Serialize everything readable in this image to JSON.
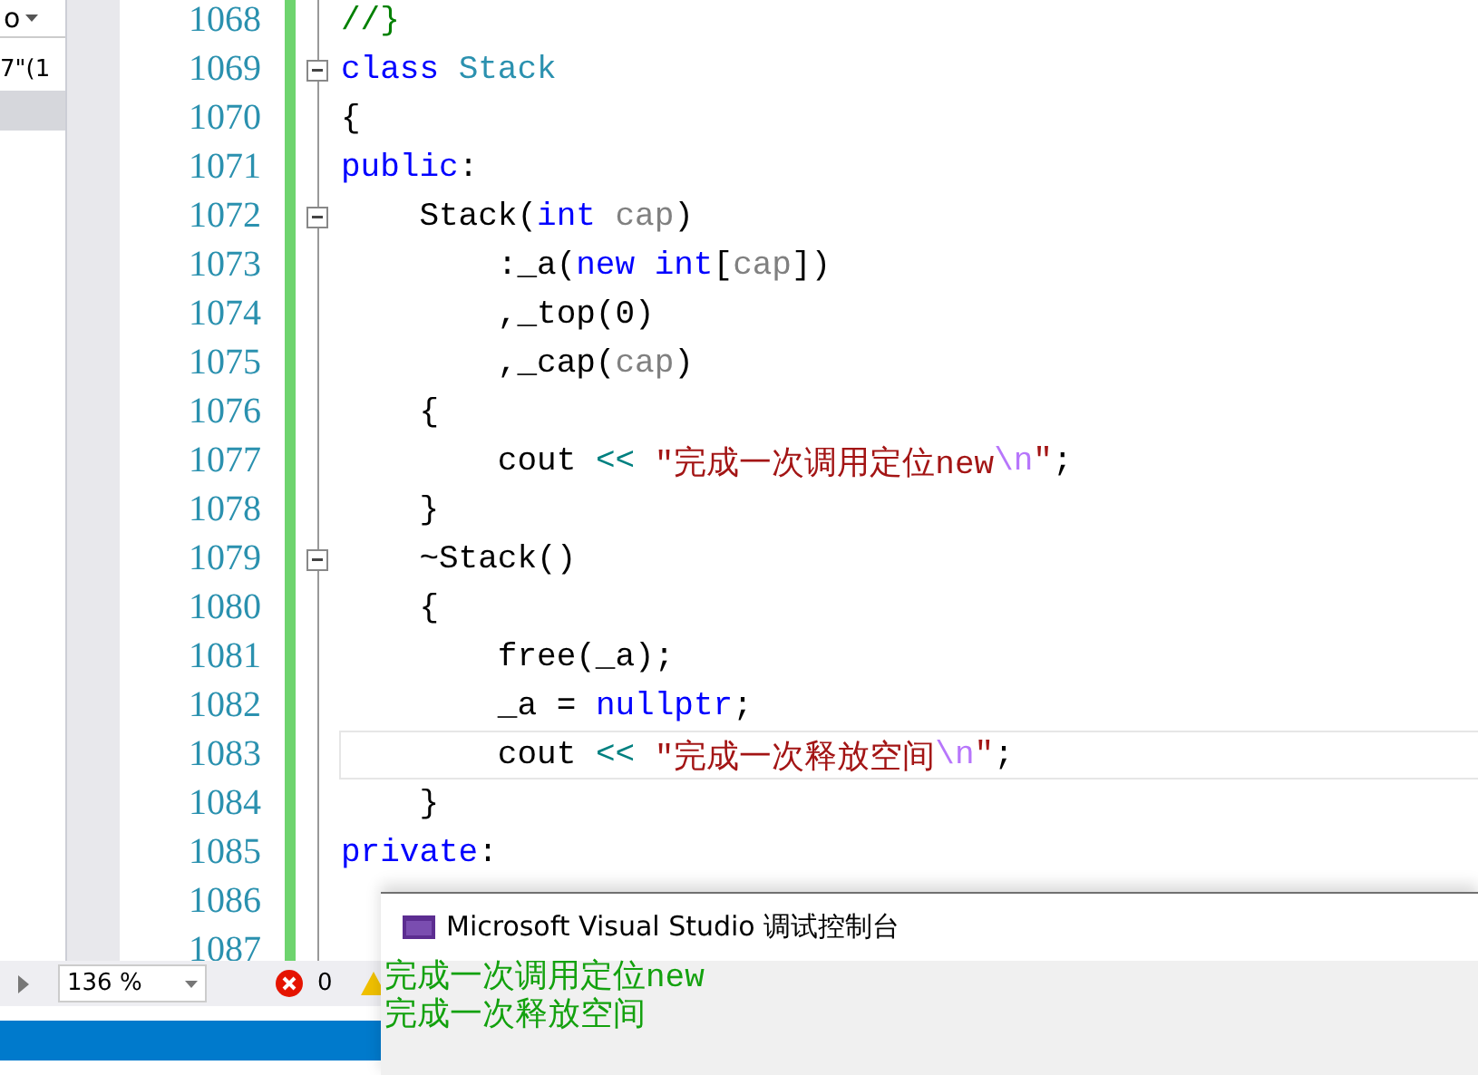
{
  "side_pane": {
    "dropdown": "o",
    "text": "7\"(1",
    "selected_row": true
  },
  "editor": {
    "lines": [
      {
        "number": "1068",
        "fold": false,
        "current": false,
        "tokens": [
          {
            "t": "//}",
            "kind": "comment"
          }
        ]
      },
      {
        "number": "1069",
        "fold": true,
        "current": false,
        "tokens": [
          {
            "t": "class",
            "kind": "keyword"
          },
          {
            "t": " Stack",
            "kind": "type"
          }
        ]
      },
      {
        "number": "1070",
        "fold": false,
        "current": false,
        "tokens": [
          {
            "t": "{",
            "kind": "plain"
          }
        ]
      },
      {
        "number": "1071",
        "fold": false,
        "current": false,
        "tokens": [
          {
            "t": "public",
            "kind": "keyword"
          },
          {
            "t": ":",
            "kind": "plain"
          }
        ]
      },
      {
        "number": "1072",
        "fold": true,
        "current": false,
        "tokens": [
          {
            "t": "    Stack(",
            "kind": "plain"
          },
          {
            "t": "int",
            "kind": "keyword"
          },
          {
            "t": " cap",
            "kind": "param"
          },
          {
            "t": ")",
            "kind": "plain"
          }
        ]
      },
      {
        "number": "1073",
        "fold": false,
        "current": false,
        "tokens": [
          {
            "t": "        :_a(",
            "kind": "plain"
          },
          {
            "t": "new",
            "kind": "keyword"
          },
          {
            "t": " int",
            "kind": "keyword"
          },
          {
            "t": "[",
            "kind": "plain"
          },
          {
            "t": "cap",
            "kind": "param"
          },
          {
            "t": "])",
            "kind": "plain"
          }
        ]
      },
      {
        "number": "1074",
        "fold": false,
        "current": false,
        "tokens": [
          {
            "t": "        ,_top(0)",
            "kind": "plain"
          }
        ]
      },
      {
        "number": "1075",
        "fold": false,
        "current": false,
        "tokens": [
          {
            "t": "        ,_cap(",
            "kind": "plain"
          },
          {
            "t": "cap",
            "kind": "param"
          },
          {
            "t": ")",
            "kind": "plain"
          }
        ]
      },
      {
        "number": "1076",
        "fold": false,
        "current": false,
        "tokens": [
          {
            "t": "    {",
            "kind": "plain"
          }
        ]
      },
      {
        "number": "1077",
        "fold": false,
        "current": false,
        "tokens": [
          {
            "t": "        cout ",
            "kind": "plain"
          },
          {
            "t": "<<",
            "kind": "operator"
          },
          {
            "t": " \"完成一次调用定位new",
            "kind": "string"
          },
          {
            "t": "\\n",
            "kind": "escape"
          },
          {
            "t": "\"",
            "kind": "string"
          },
          {
            "t": ";",
            "kind": "plain"
          }
        ]
      },
      {
        "number": "1078",
        "fold": false,
        "current": false,
        "tokens": [
          {
            "t": "    }",
            "kind": "plain"
          }
        ]
      },
      {
        "number": "1079",
        "fold": true,
        "current": false,
        "tokens": [
          {
            "t": "    ~Stack()",
            "kind": "plain"
          }
        ]
      },
      {
        "number": "1080",
        "fold": false,
        "current": false,
        "tokens": [
          {
            "t": "    {",
            "kind": "plain"
          }
        ]
      },
      {
        "number": "1081",
        "fold": false,
        "current": false,
        "tokens": [
          {
            "t": "        free(_a);",
            "kind": "plain"
          }
        ]
      },
      {
        "number": "1082",
        "fold": false,
        "current": false,
        "tokens": [
          {
            "t": "        _a = ",
            "kind": "plain"
          },
          {
            "t": "nullptr",
            "kind": "keyword"
          },
          {
            "t": ";",
            "kind": "plain"
          }
        ]
      },
      {
        "number": "1083",
        "fold": false,
        "current": true,
        "tokens": [
          {
            "t": "        cout ",
            "kind": "plain"
          },
          {
            "t": "<<",
            "kind": "operator"
          },
          {
            "t": " \"完成一次释放空间",
            "kind": "string"
          },
          {
            "t": "\\n",
            "kind": "escape"
          },
          {
            "t": "\"",
            "kind": "string"
          },
          {
            "t": ";",
            "kind": "plain"
          }
        ]
      },
      {
        "number": "1084",
        "fold": false,
        "current": false,
        "tokens": [
          {
            "t": "    }",
            "kind": "plain"
          }
        ]
      },
      {
        "number": "1085",
        "fold": false,
        "current": false,
        "tokens": [
          {
            "t": "private",
            "kind": "keyword"
          },
          {
            "t": ":",
            "kind": "plain"
          }
        ]
      },
      {
        "number": "1086"
      },
      {
        "number": "1087"
      }
    ]
  },
  "status_bar": {
    "zoom": "136 %",
    "errors": "0"
  },
  "console": {
    "title": "Microsoft Visual Studio 调试控制台",
    "lines": [
      "完成一次调用定位new",
      "完成一次释放空间"
    ]
  }
}
